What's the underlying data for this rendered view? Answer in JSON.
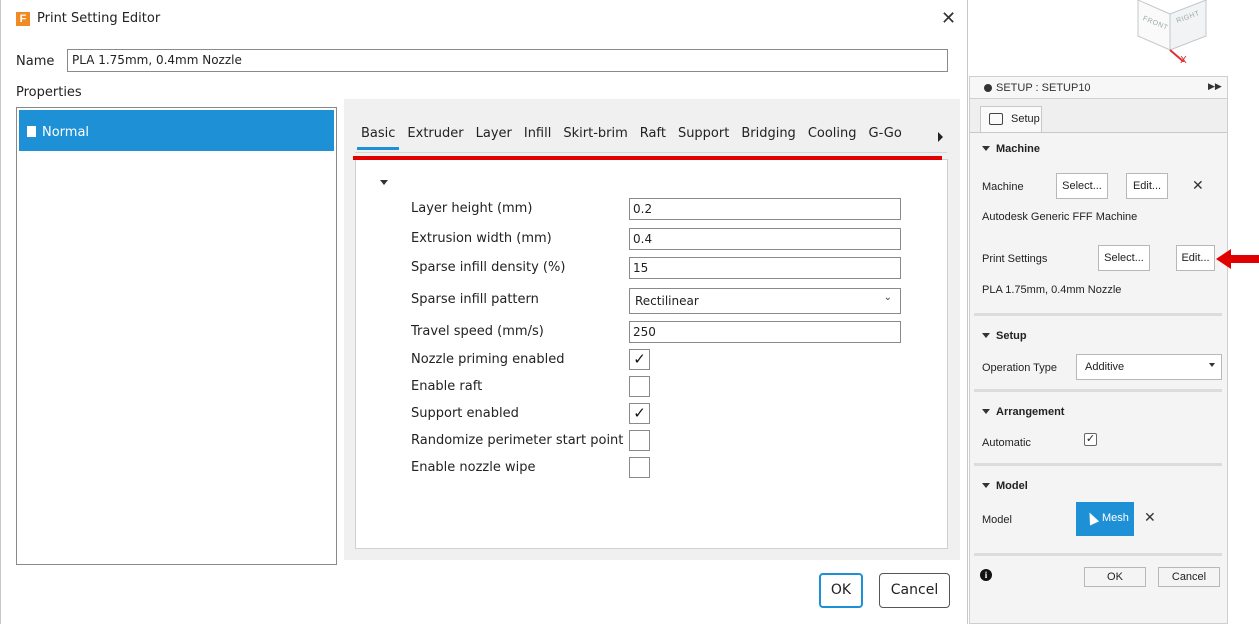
{
  "dialog": {
    "app_icon_letter": "F",
    "title": "Print Setting Editor",
    "close_label": "✕",
    "name_label": "Name",
    "name_value": "PLA 1.75mm, 0.4mm Nozzle",
    "properties_label": "Properties",
    "profile_item": "Normal",
    "tabs": [
      {
        "label": "Basic",
        "active": true
      },
      {
        "label": "Extruder"
      },
      {
        "label": "Layer"
      },
      {
        "label": "Infill"
      },
      {
        "label": "Skirt-brim"
      },
      {
        "label": "Raft"
      },
      {
        "label": "Support"
      },
      {
        "label": "Bridging"
      },
      {
        "label": "Cooling"
      },
      {
        "label": "G-Go"
      }
    ],
    "fields": [
      {
        "label": "Layer height (mm)",
        "value": "0.2"
      },
      {
        "label": "Extrusion width (mm)",
        "value": "0.4"
      },
      {
        "label": "Sparse infill density (%)",
        "value": "15"
      },
      {
        "label": "Sparse infill pattern",
        "value": "Rectilinear"
      },
      {
        "label": "Travel speed (mm/s)",
        "value": "250"
      },
      {
        "label": "Nozzle priming enabled",
        "checked": "✓"
      },
      {
        "label": "Enable raft",
        "checked": ""
      },
      {
        "label": "Support enabled",
        "checked": "✓"
      },
      {
        "label": "Randomize perimeter start point",
        "checked": ""
      },
      {
        "label": "Enable nozzle wipe",
        "checked": ""
      }
    ],
    "ok_label": "OK",
    "cancel_label": "Cancel",
    "accent_color": "#1e90d6",
    "highlight_color": "#e00000"
  },
  "viewcube": {
    "front": "FRONT",
    "right": "RIGHT",
    "axis": "X"
  },
  "panel": {
    "header_title": "SETUP : SETUP10",
    "tab_label": "Setup",
    "machine": {
      "title": "Machine",
      "label": "Machine",
      "select": "Select...",
      "edit": "Edit...",
      "clear": "✕",
      "name": "Autodesk Generic FFF Machine",
      "print_settings_label": "Print Settings",
      "ps_select": "Select...",
      "ps_edit": "Edit...",
      "print_settings_name": "PLA 1.75mm, 0.4mm Nozzle"
    },
    "setup": {
      "title": "Setup",
      "op_type_label": "Operation Type",
      "op_type_value": "Additive"
    },
    "arrangement": {
      "title": "Arrangement",
      "automatic_label": "Automatic",
      "automatic_checked": "✓"
    },
    "model": {
      "title": "Model",
      "label": "Model",
      "mesh_label": "Mesh",
      "clear": "✕"
    },
    "footer": {
      "info": "i",
      "ok": "OK",
      "cancel": "Cancel"
    }
  }
}
